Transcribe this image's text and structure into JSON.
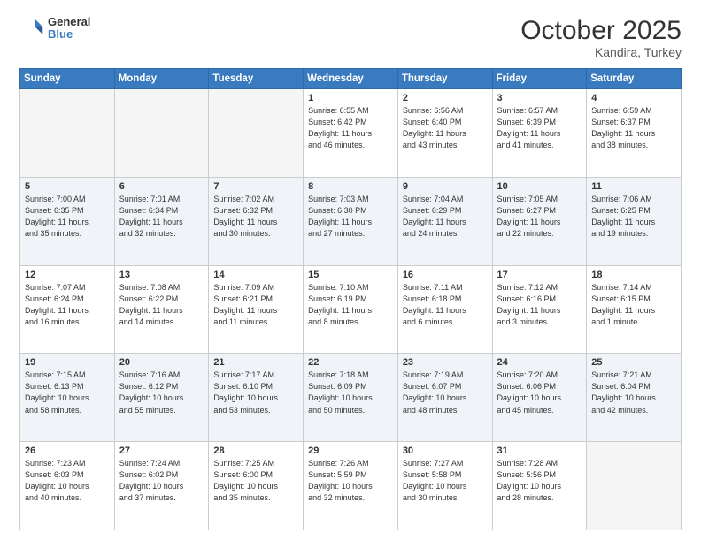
{
  "header": {
    "logo_line1": "General",
    "logo_line2": "Blue",
    "month_year": "October 2025",
    "location": "Kandira, Turkey"
  },
  "days_of_week": [
    "Sunday",
    "Monday",
    "Tuesday",
    "Wednesday",
    "Thursday",
    "Friday",
    "Saturday"
  ],
  "weeks": [
    [
      {
        "day": "",
        "info": ""
      },
      {
        "day": "",
        "info": ""
      },
      {
        "day": "",
        "info": ""
      },
      {
        "day": "1",
        "info": "Sunrise: 6:55 AM\nSunset: 6:42 PM\nDaylight: 11 hours\nand 46 minutes."
      },
      {
        "day": "2",
        "info": "Sunrise: 6:56 AM\nSunset: 6:40 PM\nDaylight: 11 hours\nand 43 minutes."
      },
      {
        "day": "3",
        "info": "Sunrise: 6:57 AM\nSunset: 6:39 PM\nDaylight: 11 hours\nand 41 minutes."
      },
      {
        "day": "4",
        "info": "Sunrise: 6:59 AM\nSunset: 6:37 PM\nDaylight: 11 hours\nand 38 minutes."
      }
    ],
    [
      {
        "day": "5",
        "info": "Sunrise: 7:00 AM\nSunset: 6:35 PM\nDaylight: 11 hours\nand 35 minutes."
      },
      {
        "day": "6",
        "info": "Sunrise: 7:01 AM\nSunset: 6:34 PM\nDaylight: 11 hours\nand 32 minutes."
      },
      {
        "day": "7",
        "info": "Sunrise: 7:02 AM\nSunset: 6:32 PM\nDaylight: 11 hours\nand 30 minutes."
      },
      {
        "day": "8",
        "info": "Sunrise: 7:03 AM\nSunset: 6:30 PM\nDaylight: 11 hours\nand 27 minutes."
      },
      {
        "day": "9",
        "info": "Sunrise: 7:04 AM\nSunset: 6:29 PM\nDaylight: 11 hours\nand 24 minutes."
      },
      {
        "day": "10",
        "info": "Sunrise: 7:05 AM\nSunset: 6:27 PM\nDaylight: 11 hours\nand 22 minutes."
      },
      {
        "day": "11",
        "info": "Sunrise: 7:06 AM\nSunset: 6:25 PM\nDaylight: 11 hours\nand 19 minutes."
      }
    ],
    [
      {
        "day": "12",
        "info": "Sunrise: 7:07 AM\nSunset: 6:24 PM\nDaylight: 11 hours\nand 16 minutes."
      },
      {
        "day": "13",
        "info": "Sunrise: 7:08 AM\nSunset: 6:22 PM\nDaylight: 11 hours\nand 14 minutes."
      },
      {
        "day": "14",
        "info": "Sunrise: 7:09 AM\nSunset: 6:21 PM\nDaylight: 11 hours\nand 11 minutes."
      },
      {
        "day": "15",
        "info": "Sunrise: 7:10 AM\nSunset: 6:19 PM\nDaylight: 11 hours\nand 8 minutes."
      },
      {
        "day": "16",
        "info": "Sunrise: 7:11 AM\nSunset: 6:18 PM\nDaylight: 11 hours\nand 6 minutes."
      },
      {
        "day": "17",
        "info": "Sunrise: 7:12 AM\nSunset: 6:16 PM\nDaylight: 11 hours\nand 3 minutes."
      },
      {
        "day": "18",
        "info": "Sunrise: 7:14 AM\nSunset: 6:15 PM\nDaylight: 11 hours\nand 1 minute."
      }
    ],
    [
      {
        "day": "19",
        "info": "Sunrise: 7:15 AM\nSunset: 6:13 PM\nDaylight: 10 hours\nand 58 minutes."
      },
      {
        "day": "20",
        "info": "Sunrise: 7:16 AM\nSunset: 6:12 PM\nDaylight: 10 hours\nand 55 minutes."
      },
      {
        "day": "21",
        "info": "Sunrise: 7:17 AM\nSunset: 6:10 PM\nDaylight: 10 hours\nand 53 minutes."
      },
      {
        "day": "22",
        "info": "Sunrise: 7:18 AM\nSunset: 6:09 PM\nDaylight: 10 hours\nand 50 minutes."
      },
      {
        "day": "23",
        "info": "Sunrise: 7:19 AM\nSunset: 6:07 PM\nDaylight: 10 hours\nand 48 minutes."
      },
      {
        "day": "24",
        "info": "Sunrise: 7:20 AM\nSunset: 6:06 PM\nDaylight: 10 hours\nand 45 minutes."
      },
      {
        "day": "25",
        "info": "Sunrise: 7:21 AM\nSunset: 6:04 PM\nDaylight: 10 hours\nand 42 minutes."
      }
    ],
    [
      {
        "day": "26",
        "info": "Sunrise: 7:23 AM\nSunset: 6:03 PM\nDaylight: 10 hours\nand 40 minutes."
      },
      {
        "day": "27",
        "info": "Sunrise: 7:24 AM\nSunset: 6:02 PM\nDaylight: 10 hours\nand 37 minutes."
      },
      {
        "day": "28",
        "info": "Sunrise: 7:25 AM\nSunset: 6:00 PM\nDaylight: 10 hours\nand 35 minutes."
      },
      {
        "day": "29",
        "info": "Sunrise: 7:26 AM\nSunset: 5:59 PM\nDaylight: 10 hours\nand 32 minutes."
      },
      {
        "day": "30",
        "info": "Sunrise: 7:27 AM\nSunset: 5:58 PM\nDaylight: 10 hours\nand 30 minutes."
      },
      {
        "day": "31",
        "info": "Sunrise: 7:28 AM\nSunset: 5:56 PM\nDaylight: 10 hours\nand 28 minutes."
      },
      {
        "day": "",
        "info": ""
      }
    ]
  ]
}
